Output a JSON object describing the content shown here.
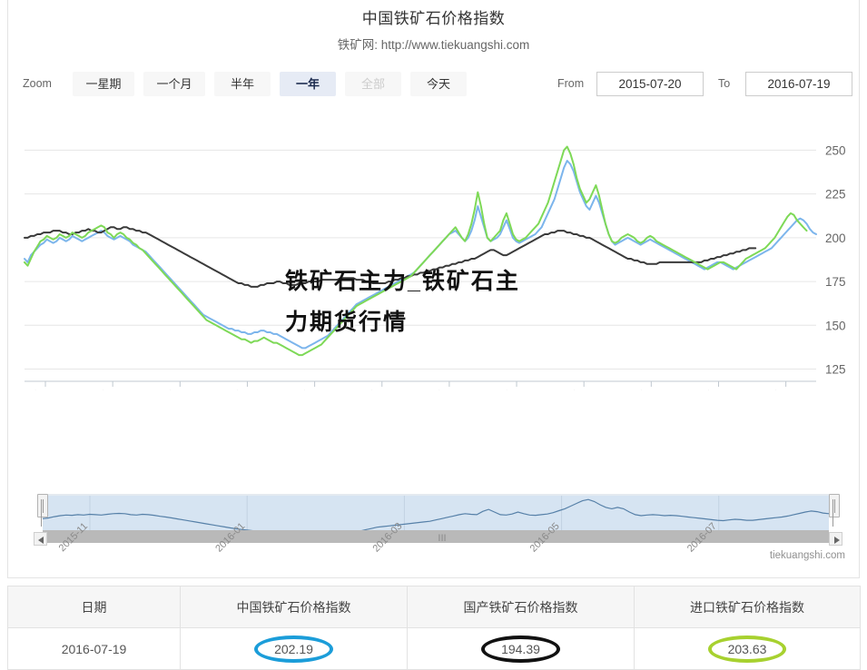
{
  "chart_title": "中国铁矿石价格指数",
  "chart_subtitle": "铁矿网: http://www.tiekuangshi.com",
  "watermark": {
    "line1": "铁矿石主力_铁矿石主",
    "line2": "力期货行情"
  },
  "credit": "tiekuangshi.com",
  "range_selector": {
    "zoom_label": "Zoom",
    "buttons": [
      {
        "label": "一星期",
        "state": "normal"
      },
      {
        "label": "一个月",
        "state": "normal"
      },
      {
        "label": "半年",
        "state": "normal"
      },
      {
        "label": "一年",
        "state": "selected"
      },
      {
        "label": "全部",
        "state": "disabled"
      },
      {
        "label": "今天",
        "state": "normal"
      }
    ],
    "from_label": "From",
    "from_value": "2015-07-20",
    "to_label": "To",
    "to_value": "2016-07-19"
  },
  "navigator": {
    "ticks": [
      "2015-11",
      "2016-01",
      "2016-03",
      "2016-05",
      "2016-07"
    ],
    "center_mark": "III",
    "left_arrow": "◀",
    "right_arrow": "▶"
  },
  "table": {
    "headers": [
      "日期",
      "中国铁矿石价格指数",
      "国产铁矿石价格指数",
      "进口铁矿石价格指数"
    ],
    "rows": [
      {
        "date": "2016-07-19",
        "china": "202.19",
        "domestic": "194.39",
        "imported": "203.63"
      }
    ],
    "highlight_colors": {
      "china": "#1b9dd9",
      "domestic": "#111111",
      "imported": "#a7d12f"
    }
  },
  "colors": {
    "series_china": "#7cb5ec",
    "series_domestic": "#3a3a3a",
    "series_imported": "#7ed957",
    "navigator_line": "#5680a8",
    "navigator_fill": "#d6e4f2",
    "grid": "#e6e6e6"
  },
  "chart_data": {
    "type": "line",
    "title": "中国铁矿石价格指数",
    "subtitle": "铁矿网: http://www.tiekuangshi.com",
    "xlabel": "",
    "ylabel": "",
    "ylim": [
      118,
      258
    ],
    "yticks": [
      125,
      150,
      175,
      200,
      225,
      250
    ],
    "grid": true,
    "legend": "none",
    "xticks": [
      "2015-08-01",
      "2015-09-01",
      "2015-10-01",
      "2015-11-01",
      "2015-12-01",
      "2016-01-01",
      "2016-02-01",
      "2016-03-01",
      "2016-04-01",
      "2016-05-01",
      "2016-06-01",
      "2016-07-01"
    ],
    "x_range": [
      "2015-07-20",
      "2016-07-19"
    ],
    "series": [
      {
        "name": "中国铁矿石价格指数",
        "color": "#7cb5ec",
        "values": [
          188,
          186,
          190,
          192,
          194,
          196,
          197,
          199,
          198,
          197,
          198,
          200,
          199,
          198,
          199,
          201,
          200,
          199,
          198,
          199,
          200,
          201,
          202,
          203,
          204,
          203,
          201,
          200,
          199,
          200,
          201,
          200,
          199,
          198,
          196,
          195,
          194,
          193,
          192,
          190,
          188,
          186,
          184,
          182,
          180,
          178,
          176,
          174,
          172,
          170,
          168,
          166,
          164,
          162,
          160,
          158,
          156,
          155,
          154,
          153,
          152,
          151,
          150,
          149,
          148,
          148,
          147,
          147,
          146,
          146,
          145,
          145,
          146,
          146,
          147,
          147,
          146,
          146,
          145,
          145,
          144,
          143,
          142,
          141,
          140,
          139,
          138,
          137,
          137,
          138,
          139,
          140,
          141,
          142,
          143,
          144,
          146,
          148,
          150,
          152,
          154,
          156,
          158,
          160,
          162,
          163,
          164,
          165,
          166,
          167,
          168,
          169,
          170,
          171,
          172,
          173,
          174,
          175,
          176,
          177,
          178,
          179,
          180,
          182,
          184,
          186,
          188,
          190,
          192,
          194,
          196,
          198,
          200,
          202,
          203,
          204,
          202,
          200,
          198,
          200,
          204,
          210,
          218,
          212,
          206,
          200,
          198,
          199,
          200,
          202,
          206,
          210,
          205,
          200,
          198,
          197,
          198,
          199,
          200,
          201,
          202,
          204,
          206,
          210,
          214,
          218,
          222,
          228,
          234,
          240,
          244,
          242,
          238,
          232,
          226,
          222,
          218,
          216,
          220,
          224,
          220,
          214,
          208,
          202,
          198,
          196,
          197,
          198,
          199,
          200,
          199,
          198,
          197,
          196,
          197,
          198,
          199,
          198,
          197,
          196,
          195,
          194,
          193,
          192,
          191,
          190,
          189,
          188,
          187,
          186,
          185,
          184,
          183,
          182,
          183,
          184,
          185,
          186,
          186,
          185,
          184,
          183,
          182,
          183,
          184,
          185,
          186,
          187,
          188,
          189,
          190,
          191,
          192,
          193,
          194,
          196,
          198,
          200,
          202,
          204,
          206,
          208,
          210,
          211,
          210,
          208,
          205,
          203,
          202
        ]
      },
      {
        "name": "国产铁矿石价格指数",
        "color": "#3a3a3a",
        "values": [
          200,
          200,
          201,
          201,
          202,
          202,
          203,
          203,
          203,
          204,
          204,
          204,
          203,
          203,
          202,
          202,
          203,
          203,
          204,
          204,
          205,
          204,
          204,
          203,
          203,
          204,
          205,
          206,
          206,
          205,
          205,
          206,
          206,
          205,
          205,
          204,
          204,
          203,
          203,
          202,
          201,
          200,
          199,
          198,
          197,
          196,
          195,
          194,
          193,
          192,
          191,
          190,
          189,
          188,
          187,
          186,
          185,
          184,
          183,
          182,
          181,
          180,
          179,
          178,
          177,
          176,
          175,
          174,
          174,
          173,
          173,
          172,
          172,
          172,
          173,
          173,
          174,
          174,
          174,
          175,
          175,
          174,
          174,
          173,
          173,
          173,
          174,
          174,
          174,
          175,
          175,
          175,
          175,
          176,
          176,
          176,
          176,
          176,
          176,
          177,
          177,
          177,
          177,
          177,
          176,
          176,
          176,
          175,
          175,
          174,
          174,
          174,
          174,
          174,
          175,
          175,
          176,
          176,
          177,
          177,
          178,
          178,
          179,
          179,
          180,
          180,
          181,
          181,
          182,
          182,
          183,
          183,
          184,
          184,
          185,
          185,
          186,
          186,
          187,
          187,
          188,
          188,
          189,
          190,
          191,
          192,
          193,
          193,
          192,
          191,
          190,
          190,
          191,
          192,
          193,
          194,
          195,
          196,
          197,
          198,
          199,
          200,
          201,
          202,
          202,
          203,
          203,
          204,
          204,
          204,
          203,
          203,
          202,
          202,
          201,
          201,
          200,
          200,
          199,
          198,
          197,
          196,
          195,
          194,
          193,
          192,
          191,
          190,
          189,
          188,
          188,
          187,
          187,
          186,
          186,
          185,
          185,
          185,
          185,
          186,
          186,
          186,
          186,
          186,
          186,
          186,
          186,
          186,
          186,
          186,
          186,
          186,
          186,
          187,
          187,
          188,
          188,
          189,
          189,
          190,
          190,
          191,
          191,
          192,
          192,
          193,
          193,
          194,
          194,
          194
        ]
      },
      {
        "name": "进口铁矿石价格指数",
        "color": "#7ed957",
        "values": [
          186,
          184,
          188,
          192,
          195,
          198,
          199,
          201,
          200,
          199,
          200,
          202,
          201,
          200,
          201,
          203,
          202,
          201,
          200,
          201,
          203,
          204,
          205,
          206,
          207,
          206,
          203,
          202,
          200,
          202,
          203,
          202,
          200,
          199,
          197,
          196,
          194,
          193,
          191,
          189,
          187,
          185,
          183,
          181,
          179,
          177,
          175,
          173,
          171,
          169,
          167,
          165,
          163,
          161,
          159,
          157,
          155,
          153,
          152,
          151,
          150,
          149,
          148,
          147,
          146,
          145,
          144,
          143,
          142,
          142,
          141,
          140,
          141,
          141,
          142,
          143,
          142,
          141,
          140,
          140,
          139,
          138,
          137,
          136,
          135,
          134,
          133,
          133,
          134,
          135,
          136,
          137,
          138,
          139,
          141,
          143,
          145,
          147,
          149,
          151,
          153,
          155,
          157,
          159,
          161,
          162,
          163,
          164,
          165,
          166,
          167,
          168,
          169,
          170,
          171,
          172,
          173,
          174,
          175,
          176,
          177,
          178,
          180,
          182,
          184,
          186,
          188,
          190,
          192,
          194,
          196,
          198,
          200,
          202,
          204,
          206,
          203,
          200,
          198,
          202,
          208,
          216,
          226,
          218,
          208,
          200,
          198,
          200,
          202,
          204,
          210,
          214,
          208,
          202,
          199,
          198,
          199,
          200,
          202,
          204,
          206,
          208,
          212,
          216,
          220,
          226,
          232,
          238,
          244,
          250,
          252,
          248,
          242,
          234,
          228,
          224,
          220,
          222,
          226,
          230,
          224,
          216,
          208,
          202,
          198,
          197,
          198,
          200,
          201,
          202,
          201,
          200,
          198,
          197,
          198,
          200,
          201,
          200,
          198,
          197,
          196,
          195,
          194,
          193,
          192,
          191,
          190,
          189,
          188,
          187,
          186,
          185,
          184,
          183,
          182,
          183,
          184,
          185,
          186,
          186,
          185,
          184,
          183,
          182,
          184,
          186,
          188,
          189,
          190,
          191,
          192,
          193,
          194,
          196,
          198,
          200,
          203,
          206,
          209,
          212,
          214,
          213,
          210,
          208,
          206,
          204
        ]
      }
    ],
    "navigator_series": {
      "name": "中国铁矿石价格指数",
      "color": "#5680a8",
      "values": [
        188,
        190,
        194,
        197,
        199,
        198,
        200,
        199,
        201,
        200,
        199,
        201,
        203,
        204,
        203,
        200,
        199,
        201,
        200,
        198,
        195,
        193,
        190,
        187,
        184,
        181,
        178,
        175,
        172,
        169,
        166,
        163,
        160,
        157,
        155,
        153,
        151,
        149,
        148,
        147,
        146,
        146,
        147,
        146,
        145,
        144,
        142,
        140,
        138,
        137,
        139,
        141,
        143,
        146,
        150,
        154,
        158,
        162,
        164,
        166,
        168,
        170,
        172,
        174,
        176,
        178,
        180,
        184,
        188,
        192,
        196,
        200,
        203,
        201,
        200,
        210,
        216,
        208,
        200,
        199,
        202,
        208,
        203,
        199,
        198,
        200,
        202,
        206,
        212,
        218,
        226,
        234,
        242,
        246,
        240,
        230,
        222,
        218,
        222,
        218,
        208,
        200,
        197,
        199,
        200,
        199,
        197,
        198,
        197,
        195,
        193,
        191,
        189,
        187,
        185,
        183,
        182,
        184,
        186,
        185,
        183,
        183,
        185,
        187,
        189,
        191,
        193,
        196,
        200,
        204,
        208,
        211,
        209,
        205,
        203
      ]
    }
  }
}
